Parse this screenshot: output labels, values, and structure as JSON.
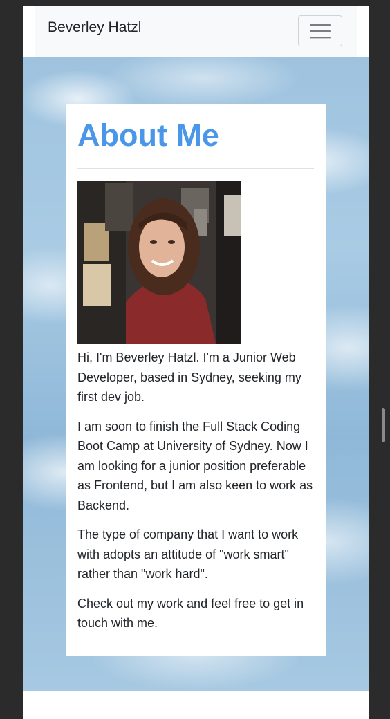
{
  "navbar": {
    "brand": "Beverley Hatzl",
    "toggle_icon": "hamburger-icon"
  },
  "about": {
    "heading": "About Me",
    "photo_alt": "Portrait of Beverley Hatzl",
    "paragraphs": [
      "Hi, I'm Beverley Hatzl. I'm a Junior Web Developer, based in Sydney, seeking my first dev job.",
      "I am soon to finish the Full Stack Coding Boot Camp at University of Sydney. Now I am looking for a junior position preferable as Frontend, but I am also keen to work as Backend.",
      "The type of company that I want to work with adopts an attitude of \"work smart\" rather than \"work hard\".",
      "Check out my work and feel free to get in touch with me."
    ]
  },
  "colors": {
    "heading": "#4a96e8",
    "navbar_bg": "#f8f9fa",
    "sky": "#9fc3df"
  }
}
